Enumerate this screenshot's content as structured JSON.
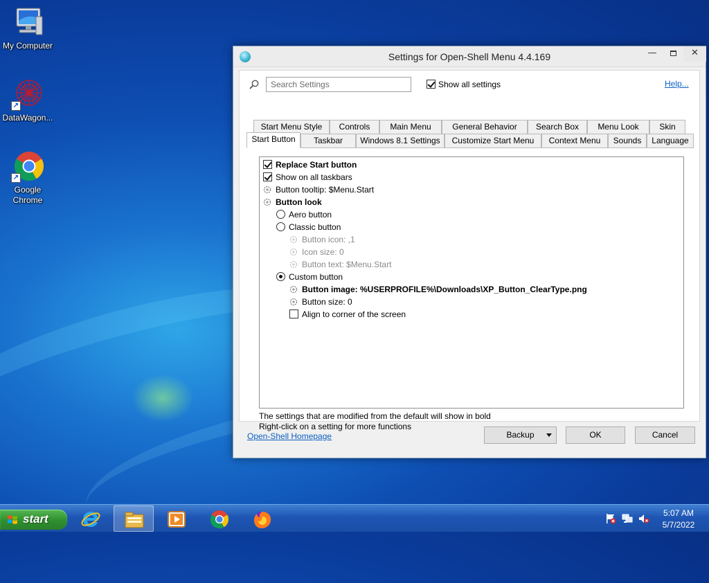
{
  "desktop": {
    "icons": [
      {
        "label": "My Computer",
        "icon": "computer-icon"
      },
      {
        "label": "DataWagon...",
        "icon": "datawagon-icon"
      },
      {
        "label": "Google Chrome",
        "icon": "chrome-icon"
      }
    ]
  },
  "dialog": {
    "title": "Settings for Open-Shell Menu 4.4.169",
    "search_placeholder": "Search Settings",
    "show_all_label": "Show all settings",
    "show_all_checked": true,
    "help_label": "Help...",
    "tabs_row1": [
      "Start Menu Style",
      "Controls",
      "Main Menu",
      "General Behavior",
      "Search Box",
      "Menu Look",
      "Skin"
    ],
    "tabs_row2": [
      "Start Button",
      "Taskbar",
      "Windows 8.1 Settings",
      "Customize Start Menu",
      "Context Menu",
      "Sounds",
      "Language"
    ],
    "active_tab": "Start Button",
    "settings": [
      {
        "type": "checkbox",
        "label": "Replace Start button",
        "checked": true,
        "bold": true
      },
      {
        "type": "checkbox",
        "label": "Show on all taskbars",
        "checked": true
      },
      {
        "type": "gear",
        "label": "Button tooltip: $Menu.Start"
      },
      {
        "type": "gear",
        "label": "Button look",
        "bold": true
      },
      {
        "type": "radio",
        "label": "Aero button",
        "checked": false
      },
      {
        "type": "radio",
        "label": "Classic button",
        "checked": false
      },
      {
        "type": "gear",
        "label": "Button icon: ,1",
        "dim": true
      },
      {
        "type": "gear",
        "label": "Icon size: 0",
        "dim": true
      },
      {
        "type": "gear",
        "label": "Button text: $Menu.Start",
        "dim": true
      },
      {
        "type": "radio",
        "label": "Custom button",
        "checked": true
      },
      {
        "type": "gear",
        "label": "Button image: %USERPROFILE%\\Downloads\\XP_Button_ClearType.png",
        "bold": true
      },
      {
        "type": "gear",
        "label": "Button size: 0"
      },
      {
        "type": "checkbox",
        "label": "Align to corner of the screen",
        "checked": false
      }
    ],
    "hint_line1": "The settings that are modified from the default will show in bold",
    "hint_line2": "Right-click on a setting for more functions",
    "homepage_label": "Open-Shell Homepage",
    "backup_label": "Backup",
    "ok_label": "OK",
    "cancel_label": "Cancel"
  },
  "taskbar": {
    "start_label": "start",
    "items": [
      "internet-explorer-icon",
      "file-explorer-icon",
      "media-player-icon",
      "chrome-icon",
      "firefox-icon"
    ],
    "active_item": "file-explorer-icon",
    "tray_icons": [
      "action-center-flag-icon",
      "network-icon",
      "volume-muted-icon"
    ],
    "time": "5:07 AM",
    "date": "5/7/2022"
  }
}
